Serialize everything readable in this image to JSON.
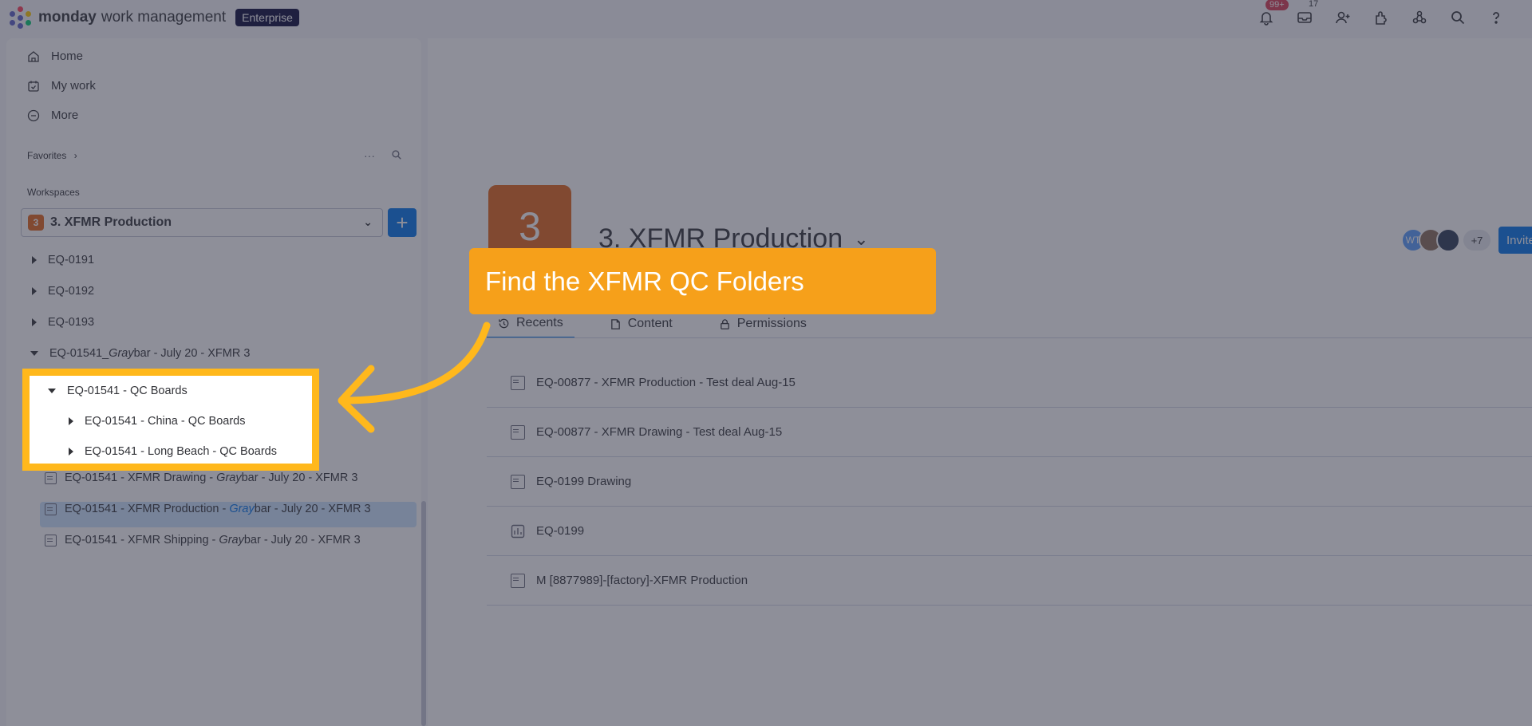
{
  "topbar": {
    "brand": "monday",
    "brand_sub": "work management",
    "plan_badge": "Enterprise",
    "notifications_count": "99+",
    "inbox_count": "17",
    "icons": [
      "bell-icon",
      "inbox-icon",
      "invite-member-icon",
      "apps-icon",
      "workflows-icon",
      "search-icon",
      "help-icon"
    ]
  },
  "sidebar": {
    "nav": [
      {
        "label": "Home",
        "icon": "home-icon"
      },
      {
        "label": "My work",
        "icon": "calendar-check-icon"
      },
      {
        "label": "More",
        "icon": "more-circle-icon"
      }
    ],
    "favorites_label": "Favorites",
    "favorites_chevron": "›",
    "workspaces_label": "Workspaces",
    "workspace_actions_more": "···",
    "workspace_icon_letter": "3",
    "workspace_name": "3. XFMR Production",
    "add_button": "+",
    "tree": [
      {
        "label": "EQ-0191"
      },
      {
        "label": "EQ-0192"
      },
      {
        "label": "EQ-0193"
      },
      {
        "label_pre": "EQ-01541_",
        "label_hl": "Gray",
        "label_post": "bar - July 20 - XFMR 3"
      },
      {
        "label": "EQ-01541 - QC Boards"
      },
      {
        "label": "EQ-01541 - China - QC Boards"
      },
      {
        "label": "EQ-01541 - Long Beach - QC Boards"
      },
      {
        "label_pre": "EQ-01541 - XFMR Drawing - ",
        "label_hl": "Gray",
        "label_post": "bar - July 20 - XFMR 3"
      },
      {
        "label_pre": "EQ-01541 - XFMR Production - ",
        "label_hl": "Gray",
        "label_post": "bar - July 20 - XFMR 3"
      },
      {
        "label_pre": "EQ-01541 - XFMR Shipping - ",
        "label_hl": "Gray",
        "label_post": "bar - July 20 - XFMR 3"
      }
    ]
  },
  "main": {
    "workspace_letter": "3",
    "title": "3. XFMR Production",
    "avatar_initials": "WT",
    "avatar_more": "+7",
    "invite_label": "Invite",
    "tabs": [
      {
        "label": "Recents",
        "icon": "history-icon"
      },
      {
        "label": "Content",
        "icon": "content-icon"
      },
      {
        "label": "Permissions",
        "icon": "lock-icon"
      }
    ],
    "recents": [
      {
        "label": "EQ-00877 - XFMR Production - Test deal Aug-15",
        "icon": "board-icon"
      },
      {
        "label": "EQ-00877 - XFMR Drawing - Test deal Aug-15",
        "icon": "board-icon"
      },
      {
        "label": "EQ-0199 Drawing",
        "icon": "board-icon"
      },
      {
        "label": "EQ-0199",
        "icon": "dashboard-icon"
      },
      {
        "label": "M [8877989]-[factory]-XFMR Production",
        "icon": "board-icon"
      }
    ]
  },
  "callout": {
    "text": "Find the XFMR QC Folders",
    "color": "#f6a01a",
    "highlight_color": "#ffb81c"
  }
}
